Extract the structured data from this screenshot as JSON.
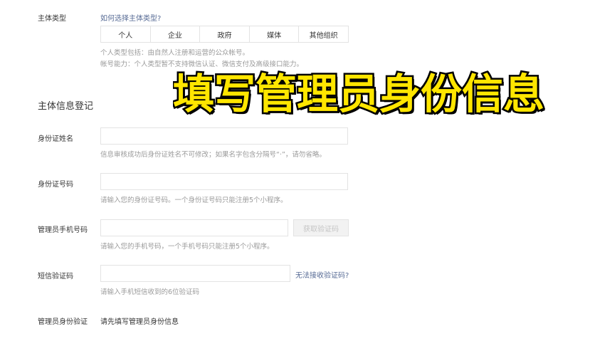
{
  "subject_type": {
    "label": "主体类型",
    "help_link": "如何选择主体类型?",
    "options": [
      "个人",
      "企业",
      "政府",
      "媒体",
      "其他组织"
    ],
    "hint_line1": "个人类型包括：由自然人注册和运营的公众帐号。",
    "hint_line2": "帐号能力：个人类型暂不支持微信认证、微信支付及高级接口能力。"
  },
  "section_title": "主体信息登记",
  "overlay_caption": "填写管理员身份信息",
  "fields": {
    "id_name": {
      "label": "身份证姓名",
      "value": "",
      "hint": "信息审核成功后身份证姓名不可修改；如果名字包含分隔号“·”，请勿省略。"
    },
    "id_number": {
      "label": "身份证号码",
      "value": "",
      "hint": "请输入您的身份证号码。一个身份证号码只能注册5个小程序。"
    },
    "phone": {
      "label": "管理员手机号码",
      "value": "",
      "button": "获取验证码",
      "hint": "请输入您的手机号码，一个手机号码只能注册5个小程序。"
    },
    "sms_code": {
      "label": "短信验证码",
      "value": "",
      "link": "无法接收验证码?",
      "hint": "请输入手机短信收到的6位验证码"
    },
    "admin_verify": {
      "label": "管理员身份验证",
      "text": "请先填写管理员身份信息"
    }
  },
  "colors": {
    "link": "#576b95",
    "overlay_fill": "#ffe600",
    "overlay_stroke": "#000000",
    "border": "#e3e3e3",
    "hint": "#9a9a9a"
  }
}
